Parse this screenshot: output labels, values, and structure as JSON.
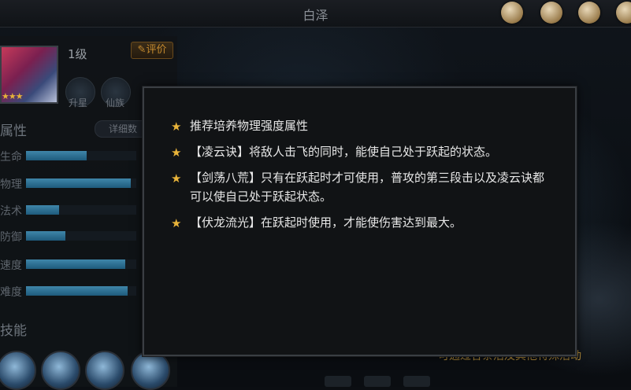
{
  "header": {
    "title": "白泽"
  },
  "hero": {
    "level": "1级",
    "rate_button": "评价",
    "badges": [
      "升星",
      "仙族"
    ]
  },
  "attributes": {
    "title": "属性",
    "detail_button": "详细数",
    "stats": [
      {
        "label": "生命",
        "fill": 0.55
      },
      {
        "label": "物理",
        "fill": 0.95
      },
      {
        "label": "法术",
        "fill": 0.3
      },
      {
        "label": "防御",
        "fill": 0.36
      },
      {
        "label": "速度",
        "fill": 0.9
      },
      {
        "label": "难度",
        "fill": 0.92
      }
    ]
  },
  "skills": {
    "title": "技能"
  },
  "bottom_hint": "可通过各条活及其他特殊活动",
  "dialog": {
    "tips": [
      "推荐培养物理强度属性",
      "【凌云诀】将敌人击飞的同时，能使自己处于跃起的状态。",
      "【剑荡八荒】只有在跃起时才可使用，普攻的第三段击以及凌云诀都可以使自己处于跃起状态。",
      "【伏龙流光】在跃起时使用，才能使伤害达到最大。"
    ]
  }
}
